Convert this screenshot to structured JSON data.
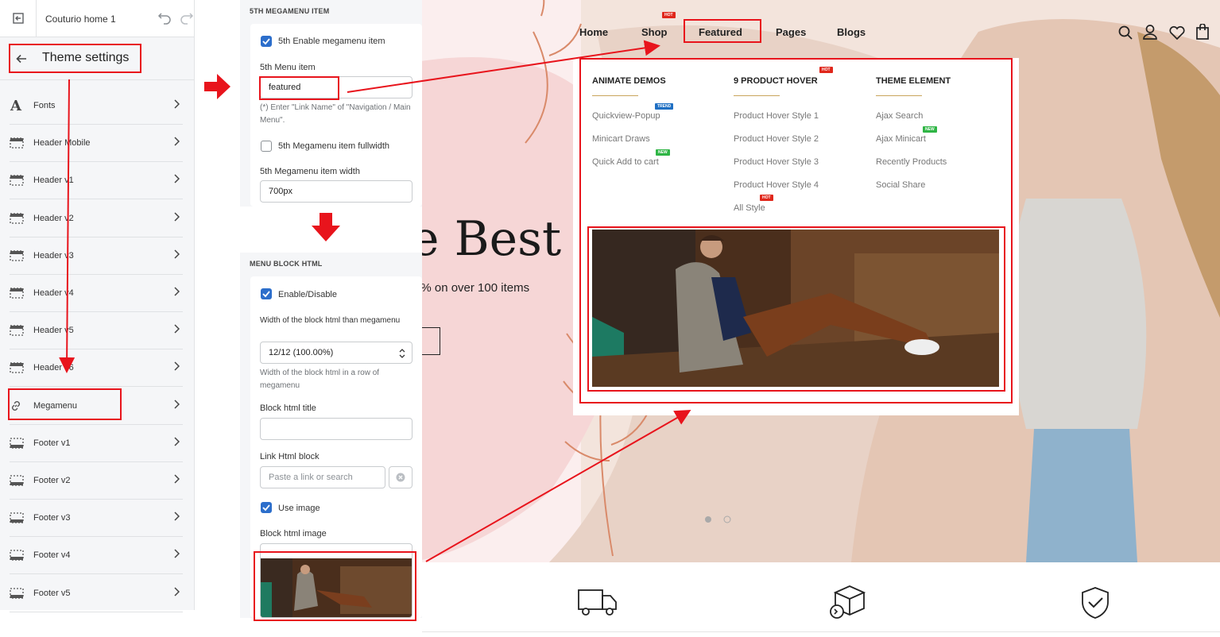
{
  "sidebar": {
    "theme_name": "Couturio home 1",
    "title": "Theme settings",
    "items": [
      {
        "label": "Fonts",
        "icon": "font-icon"
      },
      {
        "label": "Header Mobile",
        "icon": "header-layout-icon"
      },
      {
        "label": "Header v1",
        "icon": "header-layout-icon"
      },
      {
        "label": "Header v2",
        "icon": "header-layout-icon"
      },
      {
        "label": "Header v3",
        "icon": "header-layout-icon"
      },
      {
        "label": "Header v4",
        "icon": "header-layout-icon"
      },
      {
        "label": "Header v5",
        "icon": "header-layout-icon"
      },
      {
        "label": "Header v6",
        "icon": "header-layout-icon"
      },
      {
        "label": "Megamenu",
        "icon": "link-icon"
      },
      {
        "label": "Footer v1",
        "icon": "footer-layout-icon"
      },
      {
        "label": "Footer v2",
        "icon": "footer-layout-icon"
      },
      {
        "label": "Footer v3",
        "icon": "footer-layout-icon"
      },
      {
        "label": "Footer v4",
        "icon": "footer-layout-icon"
      },
      {
        "label": "Footer v5",
        "icon": "footer-layout-icon"
      }
    ]
  },
  "megamenu_item": {
    "section_title": "5TH MEGAMENU ITEM",
    "enable_label": "5th Enable megamenu item",
    "menu_item_label": "5th Menu item",
    "menu_item_value": "featured",
    "menu_item_help": "(*) Enter \"Link Name\" of \"Navigation / Main Menu\".",
    "fullwidth_label": "5th Megamenu item fullwidth",
    "width_label": "5th Megamenu item width",
    "width_value": "700px"
  },
  "menu_block": {
    "section_title": "MENU BLOCK HTML",
    "enable_label": "Enable/Disable",
    "width_label": "Width of the block html than megamenu",
    "width_value": "12/12 (100.00%)",
    "width_help": "Width of the block html in a row of megamenu",
    "title_label": "Block html title",
    "title_value": "",
    "link_label": "Link Html block",
    "link_placeholder": "Paste a link or search",
    "use_image_label": "Use image",
    "image_label": "Block html image"
  },
  "store": {
    "nav": [
      "Home",
      "Shop",
      "Featured",
      "Pages",
      "Blogs"
    ],
    "shop_badge": "HOT",
    "hero_title": "e Best I",
    "hero_subtitle": "0% on over 100 items",
    "mega": {
      "columns": [
        {
          "heading": "ANIMATE DEMOS",
          "links": [
            "Quickview-Popup",
            "Minicart Draws",
            "Quick Add to cart"
          ],
          "badges": [
            "TREND",
            "",
            "NEW"
          ]
        },
        {
          "heading": "9 PRODUCT HOVER",
          "heading_badge": "HOT",
          "links": [
            "Product Hover Style 1",
            "Product Hover Style 2",
            "Product Hover Style 3",
            "Product Hover Style 4",
            "All Style"
          ],
          "badges": [
            "",
            "",
            "",
            "",
            "HOT"
          ]
        },
        {
          "heading": "THEME ELEMENT",
          "links": [
            "Ajax Search",
            "Ajax Minicart",
            "Recently Products",
            "Social Share"
          ],
          "badges": [
            "",
            "NEW",
            "",
            ""
          ]
        }
      ]
    }
  },
  "colors": {
    "annotation_red": "#e8141c",
    "checkbox_blue": "#2c6ecb",
    "hot_badge": "#e0271b",
    "trend_badge": "#1f6fc3",
    "new_badge": "#2fb545",
    "accent_gold": "#c9a55c"
  }
}
